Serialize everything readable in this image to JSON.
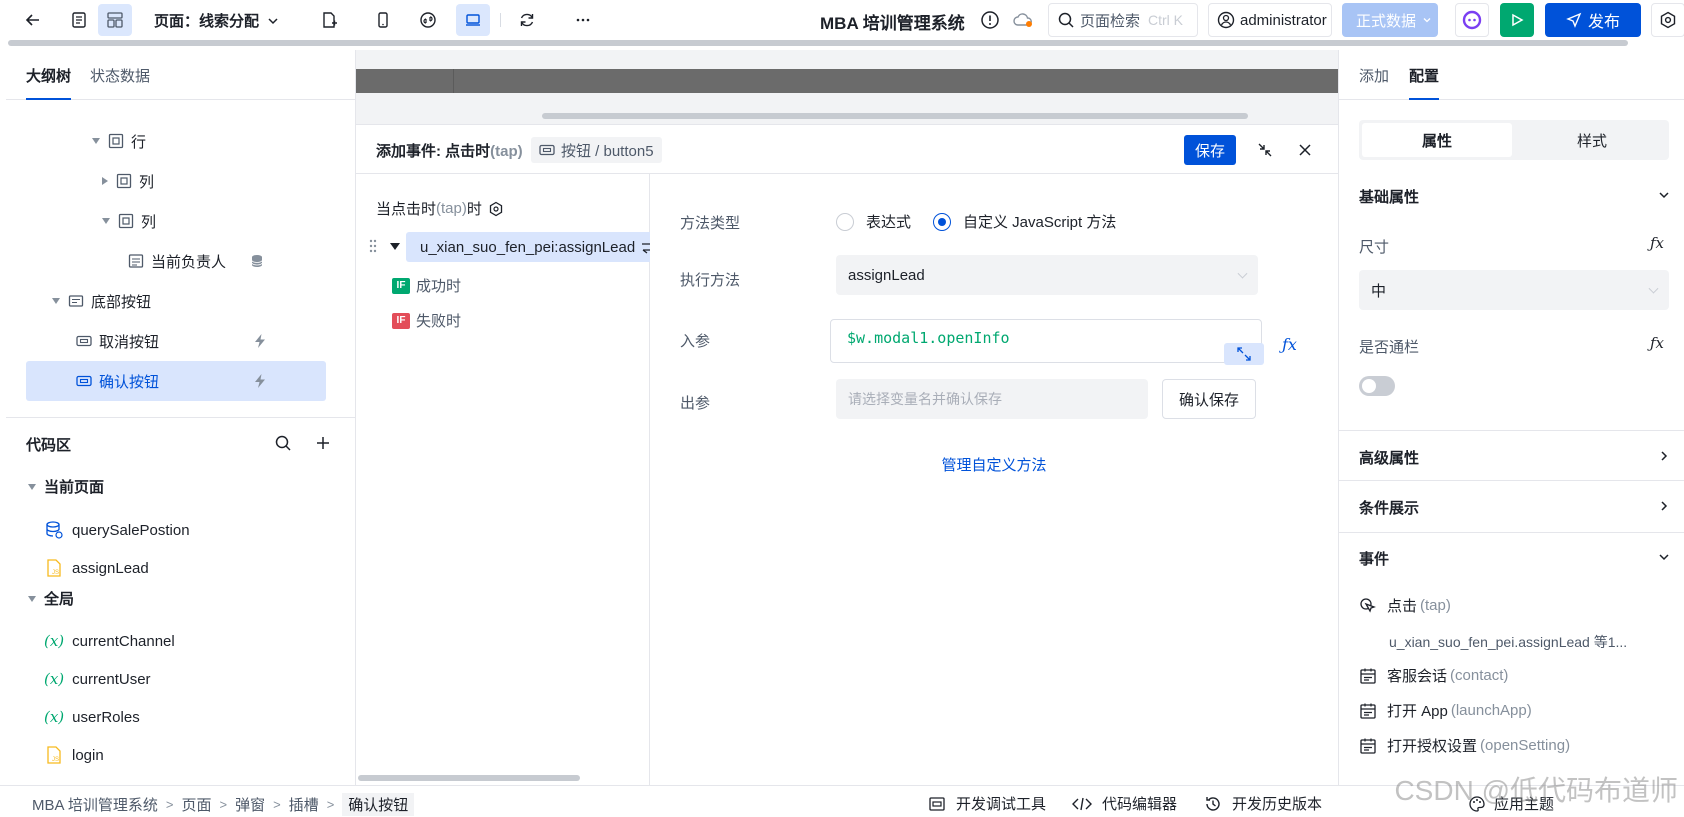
{
  "colors": {
    "primary": "#0052d9",
    "green": "#00a870",
    "red": "#e34d59",
    "code_green": "#00a870",
    "link": "#0052d9"
  },
  "topbar": {
    "page_label": "页面：",
    "page_name": "线索分配",
    "app_title": "MBA 培训管理系统",
    "search_placeholder": "页面检索",
    "search_shortcut": "Ctrl K",
    "user": "administrator",
    "env": "正式数据",
    "publish": "发布"
  },
  "left": {
    "tabs": [
      "大纲树",
      "状态数据"
    ],
    "tree": [
      {
        "label": "行",
        "expanded": true
      },
      {
        "label": "列",
        "expanded": false
      },
      {
        "label": "列",
        "expanded": true
      },
      {
        "label": "当前负责人"
      },
      {
        "label": "底部按钮",
        "expanded": true
      },
      {
        "label": "取消按钮"
      },
      {
        "label": "确认按钮",
        "selected": true
      }
    ],
    "code_title": "代码区",
    "groups": [
      {
        "label": "当前页面",
        "items": [
          "querySalePostion",
          "assignLead"
        ]
      },
      {
        "label": "全局",
        "items": [
          "currentChannel",
          "currentUser",
          "userRoles",
          "login"
        ]
      }
    ]
  },
  "event": {
    "title": "添加事件: 点击时",
    "title_key": "(tap)",
    "component": "按钮 / button5",
    "save": "保存",
    "trigger": "当点击时",
    "trigger_key": "(tap)",
    "trigger_suffix": "时",
    "action": "u_xian_suo_fen_pei:assignLead",
    "success": "成功时",
    "fail": "失败时",
    "if_badge": "IF",
    "form": {
      "method_type_label": "方法类型",
      "opt_expression": "表达式",
      "opt_custom": "自定义 JavaScript 方法",
      "exec_label": "执行方法",
      "exec_value": "assignLead",
      "input_label": "入参",
      "input_value": "$w.modal1.openInfo",
      "output_label": "出参",
      "output_placeholder": "请选择变量名并确认保存",
      "confirm_save": "确认保存",
      "manage": "管理自定义方法"
    }
  },
  "right": {
    "tabs": [
      "添加",
      "配置"
    ],
    "seg": [
      "属性",
      "样式"
    ],
    "basic": "基础属性",
    "size_label": "尺寸",
    "size_value": "中",
    "full_label": "是否通栏",
    "advanced": "高级属性",
    "cond": "条件展示",
    "events": "事件",
    "ev_tap": "点击",
    "ev_tap_key": "(tap)",
    "ev_tap_detail": "u_xian_suo_fen_pei.assignLead 等1...",
    "ev_contact": "客服会话",
    "ev_contact_key": "(contact)",
    "ev_launch": "打开 App",
    "ev_launch_key": "(launchApp)",
    "ev_setting": "打开授权设置",
    "ev_setting_key": "(openSetting)"
  },
  "footer": {
    "crumbs": [
      "MBA 培训管理系统",
      "页面",
      "弹窗",
      "插槽",
      "确认按钮"
    ],
    "debug": "开发调试工具",
    "code_editor": "代码编辑器",
    "history": "开发历史版本",
    "theme": "应用主题",
    "watermark": "CSDN @低代码布道师"
  }
}
